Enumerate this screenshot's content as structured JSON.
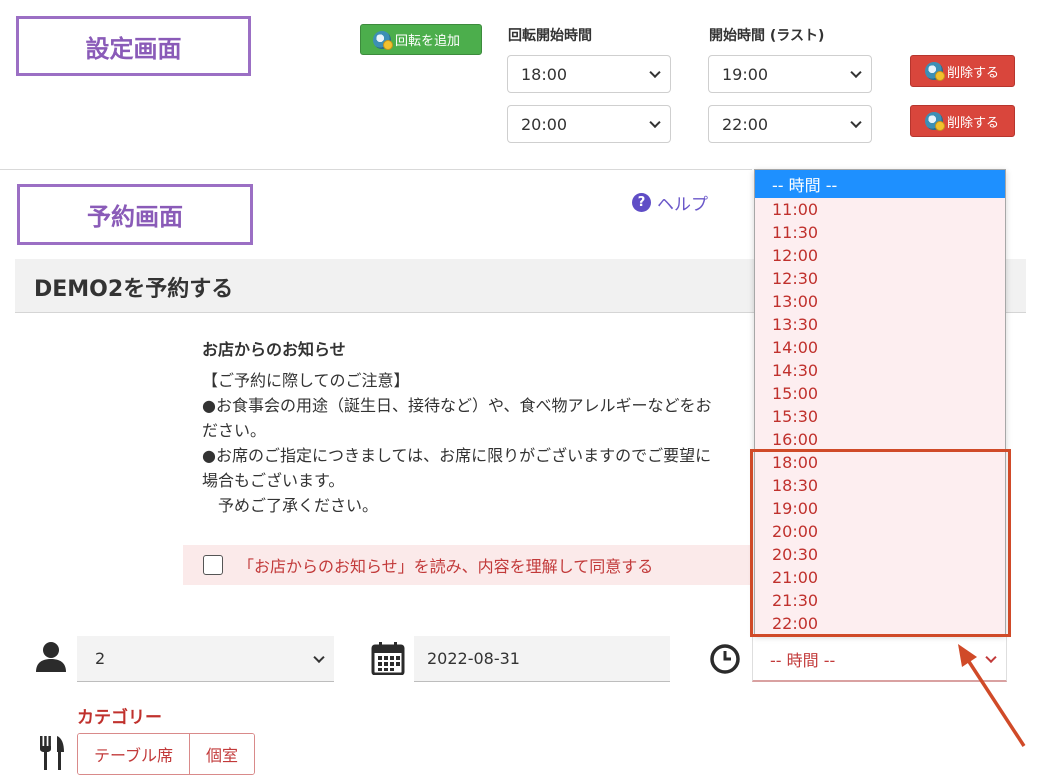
{
  "labels": {
    "settings": "設定画面",
    "reservation": "予約画面"
  },
  "settings": {
    "add_rotation": "回転を追加",
    "col_rotation_start": "回転開始時間",
    "col_start_last": "開始時間 (ラスト)",
    "rows": [
      {
        "rotation_start": "18:00",
        "start_last": "19:00",
        "delete": "削除する"
      },
      {
        "rotation_start": "20:00",
        "start_last": "22:00",
        "delete": "削除する"
      }
    ]
  },
  "help": {
    "icon": "question-icon",
    "label": "ヘルプ"
  },
  "page_title": "DEMO2を予約する",
  "notice": {
    "title": "お店からのお知らせ",
    "lines": [
      "【ご予約に際してのご注意】",
      "●お食事会の用途（誕生日、接待など）や、食べ物アレルギーなどをお",
      "ださい。",
      "●お席のご指定につきましては、お席に限りがございますのでご要望に",
      "場合もございます。",
      "　予めご了承ください。"
    ]
  },
  "agree": {
    "label": "「お店からのお知らせ」を読み、内容を理解して同意する",
    "checked": false
  },
  "form": {
    "party_size": "2",
    "date": "2022-08-31",
    "time_placeholder": "-- 時間 --",
    "category_title": "カテゴリー",
    "categories": [
      "テーブル席",
      "個室"
    ]
  },
  "dropdown": {
    "header": "-- 時間 --",
    "options": [
      "11:00",
      "11:30",
      "12:00",
      "12:30",
      "13:00",
      "13:30",
      "14:00",
      "14:30",
      "15:00",
      "15:30",
      "16:00",
      "18:00",
      "18:30",
      "19:00",
      "20:00",
      "20:30",
      "21:00",
      "21:30",
      "22:00"
    ]
  },
  "colors": {
    "accent_purple": "#9b6fc4",
    "add_green": "#4cae4c",
    "delete_red": "#d9463c",
    "highlight_orange": "#d04a28",
    "dropdown_selected": "#1e90ff",
    "error_red": "#c0312d"
  }
}
